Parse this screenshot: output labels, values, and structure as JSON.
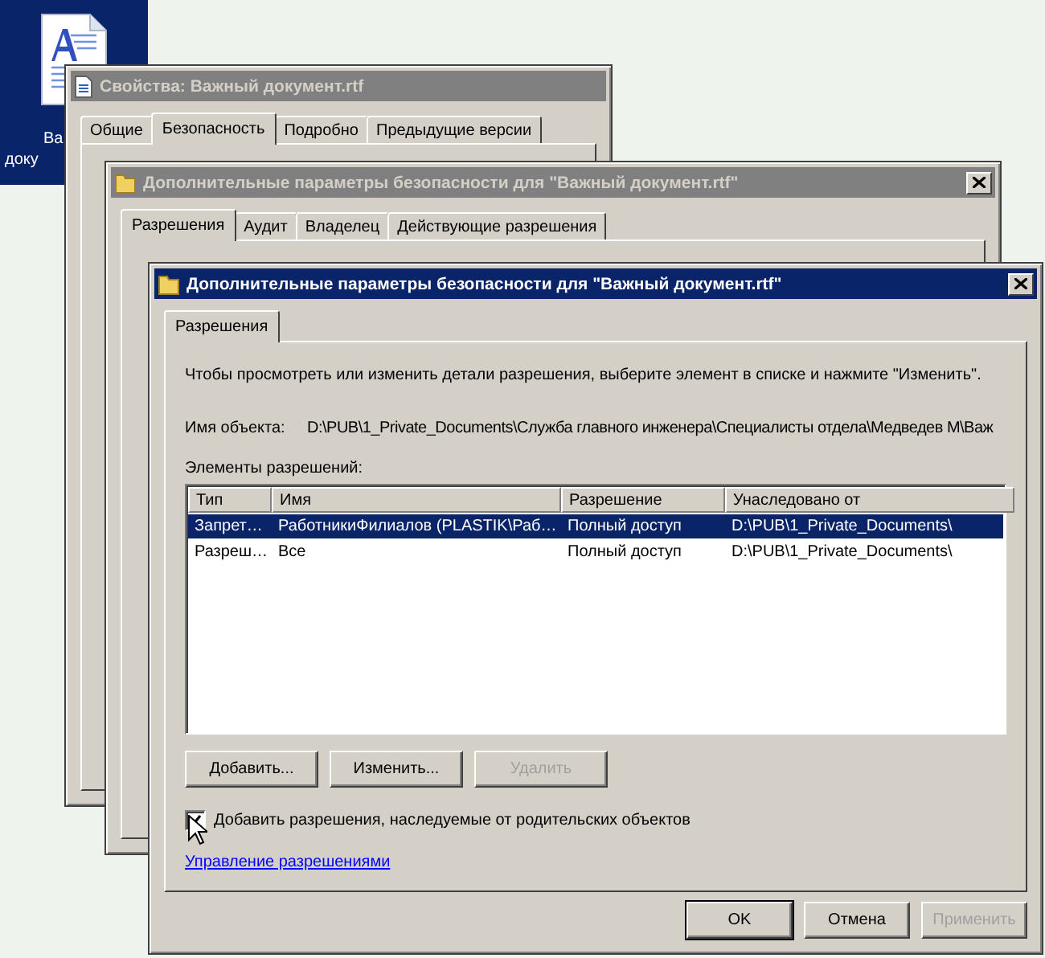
{
  "desktop_icon": {
    "label_lines": [
      "Ва",
      "доку"
    ],
    "selected": true
  },
  "background_windows": [
    {
      "title": "Свойства: Важный документ.rtf",
      "active": false,
      "tabs": [
        {
          "label": "Общие",
          "selected": false
        },
        {
          "label": "Безопасность",
          "selected": true
        },
        {
          "label": "Подробно",
          "selected": false
        },
        {
          "label": "Предыдущие версии",
          "selected": false
        }
      ]
    },
    {
      "title": "Дополнительные параметры безопасности  для \"Важный документ.rtf\"",
      "active": false,
      "tabs": [
        {
          "label": "Разрешения",
          "selected": true
        },
        {
          "label": "Аудит",
          "selected": false
        },
        {
          "label": "Владелец",
          "selected": false
        },
        {
          "label": "Действующие разрешения",
          "selected": false
        }
      ]
    }
  ],
  "dialog": {
    "title": "Дополнительные параметры безопасности  для \"Важный документ.rtf\"",
    "active": true,
    "tabs": [
      {
        "label": "Разрешения",
        "selected": true
      }
    ],
    "intro": "Чтобы просмотреть или изменить детали разрешения, выберите элемент в списке и нажмите \"Изменить\".",
    "object_label": "Имя объекта:",
    "object_path": "D:\\PUB\\1_Private_Documents\\Служба главного инженера\\Специалисты отдела\\Медведев М\\Важ",
    "list_label": "Элементы разрешений:",
    "columns": [
      "Тип",
      "Имя",
      "Разрешение",
      "Унаследовано от"
    ],
    "rows": [
      {
        "cells": [
          "Запрет…",
          "РаботникиФилиалов (PLASTIK\\Раб…",
          "Полный доступ",
          "D:\\PUB\\1_Private_Documents\\"
        ],
        "selected": true
      },
      {
        "cells": [
          "Разреш…",
          "Все",
          "Полный доступ",
          "D:\\PUB\\1_Private_Documents\\"
        ],
        "selected": false
      }
    ],
    "list_buttons": [
      {
        "label": "Добавить...",
        "disabled": false
      },
      {
        "label": "Изменить...",
        "disabled": false
      },
      {
        "label": "Удалить",
        "disabled": true
      }
    ],
    "inherit_checkbox": {
      "label": "Добавить разрешения, наследуемые от родительских объектов",
      "checked": true
    },
    "manage_link": "Управление разрешениями",
    "footer_buttons": [
      {
        "label": "OK",
        "disabled": false,
        "default": true
      },
      {
        "label": "Отмена",
        "disabled": false,
        "default": false
      },
      {
        "label": "Применить",
        "disabled": true,
        "default": false
      }
    ]
  }
}
